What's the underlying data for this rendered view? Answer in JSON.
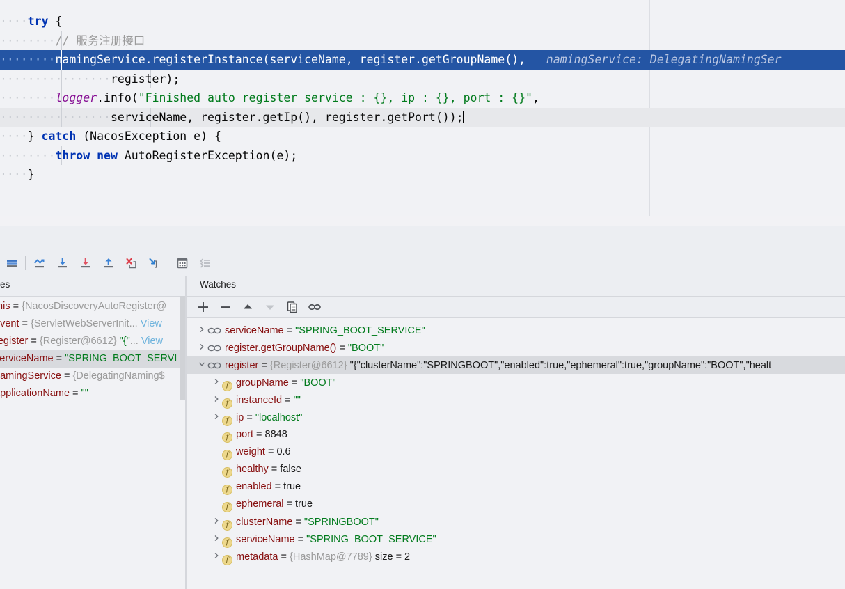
{
  "editor": {
    "lines": [
      {
        "indent_dots": "····",
        "guides": [],
        "segments": [
          {
            "t": "try",
            "c": "kw"
          },
          {
            "t": " {",
            "c": "plain"
          }
        ]
      },
      {
        "indent_dots": "········",
        "guides": [
          88
        ],
        "segments": [
          {
            "t": "// 服务注册接口",
            "c": "cmt"
          }
        ]
      },
      {
        "indent_dots": "········",
        "guides": [
          88
        ],
        "selected": true,
        "segments": [
          {
            "t": "namingService.registerInstance(",
            "c": "plain"
          },
          {
            "t": "serviceName",
            "c": "underl"
          },
          {
            "t": ", register.getGroupName(),",
            "c": "plain"
          }
        ],
        "hint": "namingService: DelegatingNamingSer"
      },
      {
        "indent_dots": "················",
        "guides": [
          88,
          216
        ],
        "segments": [
          {
            "t": "register);",
            "c": "plain"
          }
        ]
      },
      {
        "indent_dots": "········",
        "guides": [
          88
        ],
        "segments": [
          {
            "t": "logger",
            "c": "fld"
          },
          {
            "t": ".info(",
            "c": "plain"
          },
          {
            "t": "\"Finished auto register service : {}, ip : {}, port : {}\"",
            "c": "str"
          },
          {
            "t": ",",
            "c": "plain"
          }
        ]
      },
      {
        "indent_dots": "················",
        "guides": [
          88,
          216
        ],
        "caret_line": true,
        "segments": [
          {
            "t": "serviceName",
            "c": "underl"
          },
          {
            "t": ", register.getIp(), register.getPort());",
            "c": "plain"
          }
        ],
        "caret": true
      },
      {
        "indent_dots": "····",
        "guides": [],
        "segments": [
          {
            "t": "} ",
            "c": "plain"
          },
          {
            "t": "catch",
            "c": "kw"
          },
          {
            "t": " (NacosException e) {",
            "c": "plain"
          }
        ]
      },
      {
        "indent_dots": "········",
        "guides": [
          88
        ],
        "segments": [
          {
            "t": "throw",
            "c": "kw"
          },
          {
            "t": " ",
            "c": "plain"
          },
          {
            "t": "new",
            "c": "kw"
          },
          {
            "t": " AutoRegisterException(e);",
            "c": "plain"
          }
        ]
      },
      {
        "indent_dots": "····",
        "guides": [],
        "segments": [
          {
            "t": "}",
            "c": "plain"
          }
        ]
      }
    ],
    "scrollbar": {
      "orientation": "horizontal"
    }
  },
  "debug_toolbar": {
    "buttons": [
      {
        "name": "show-execution-point-icon",
        "label": "Show Execution Point"
      },
      {
        "name": "step-over-icon",
        "label": "Step Over"
      },
      {
        "name": "step-into-icon",
        "label": "Step Into"
      },
      {
        "name": "force-step-into-icon",
        "label": "Force Step Into"
      },
      {
        "name": "step-out-icon",
        "label": "Step Out"
      },
      {
        "name": "drop-frame-icon",
        "label": "Drop Frame"
      },
      {
        "name": "run-to-cursor-icon",
        "label": "Run to Cursor"
      },
      {
        "name": "evaluate-expression-icon",
        "label": "Evaluate Expression"
      },
      {
        "name": "sort-values-icon",
        "label": "Sort Values"
      }
    ]
  },
  "variables_panel": {
    "tab_label": "es",
    "rows": [
      {
        "name": "this",
        "eq": " = ",
        "obj": "{NacosDiscoveryAutoRegister@",
        "value": "",
        "link": ""
      },
      {
        "name": "event",
        "eq": " = ",
        "obj": "{ServletWebServerInit",
        "ellipsis": "... ",
        "link": "View"
      },
      {
        "name": "register",
        "eq": " = ",
        "obj": "{Register@6612} ",
        "value": "\"{\"",
        "ellipsis": "... ",
        "link": "View"
      },
      {
        "name": "serviceName",
        "eq": " = ",
        "value": "\"SPRING_BOOT_SERVI",
        "selected": true
      },
      {
        "name": "namingService",
        "eq": " = ",
        "obj": "{DelegatingNaming$"
      },
      {
        "name": "applicationName",
        "eq": " = ",
        "value": "\"\""
      }
    ]
  },
  "watches_panel": {
    "tab_label": "Watches",
    "toolbar": [
      {
        "name": "add-watch-button",
        "label": "+"
      },
      {
        "name": "remove-watch-button",
        "label": "−"
      },
      {
        "name": "move-watch-up-button",
        "label": "▲"
      },
      {
        "name": "move-watch-down-button",
        "label": "▼"
      },
      {
        "name": "copy-value-button",
        "label": "copy"
      },
      {
        "name": "watch-glasses-button",
        "label": "watch"
      }
    ],
    "rows": [
      {
        "indent": 0,
        "twisty": "collapsed",
        "icon": "watch",
        "name": "serviceName",
        "eq": " = ",
        "value": "\"SPRING_BOOT_SERVICE\"",
        "value_kind": "string"
      },
      {
        "indent": 0,
        "twisty": "collapsed",
        "icon": "watch",
        "name": "register.getGroupName()",
        "eq": " = ",
        "value": "\"BOOT\"",
        "value_kind": "string"
      },
      {
        "indent": 0,
        "twisty": "expanded",
        "icon": "watch",
        "name": "register",
        "eq": " = ",
        "obj": "{Register@6612} ",
        "value": "\"{\"clusterName\":\"SPRINGBOOT\",\"enabled\":true,\"ephemeral\":true,\"groupName\":\"BOOT\",\"healt",
        "value_kind": "raw",
        "selected": true
      },
      {
        "indent": 1,
        "twisty": "collapsed",
        "icon": "field",
        "name": "groupName",
        "eq": " = ",
        "value": "\"BOOT\"",
        "value_kind": "string"
      },
      {
        "indent": 1,
        "twisty": "collapsed",
        "icon": "field",
        "name": "instanceId",
        "eq": " = ",
        "value": "\"\"",
        "value_kind": "string"
      },
      {
        "indent": 1,
        "twisty": "collapsed",
        "icon": "field",
        "name": "ip",
        "eq": " = ",
        "value": "\"localhost\"",
        "value_kind": "string"
      },
      {
        "indent": 1,
        "twisty": "none",
        "icon": "field",
        "name": "port",
        "eq": " = ",
        "value": "8848",
        "value_kind": "number"
      },
      {
        "indent": 1,
        "twisty": "none",
        "icon": "field",
        "name": "weight",
        "eq": " = ",
        "value": "0.6",
        "value_kind": "number"
      },
      {
        "indent": 1,
        "twisty": "none",
        "icon": "field",
        "name": "healthy",
        "eq": " = ",
        "value": "false",
        "value_kind": "number"
      },
      {
        "indent": 1,
        "twisty": "none",
        "icon": "field",
        "name": "enabled",
        "eq": " = ",
        "value": "true",
        "value_kind": "number"
      },
      {
        "indent": 1,
        "twisty": "none",
        "icon": "field",
        "name": "ephemeral",
        "eq": " = ",
        "value": "true",
        "value_kind": "number"
      },
      {
        "indent": 1,
        "twisty": "collapsed",
        "icon": "field",
        "name": "clusterName",
        "eq": " = ",
        "value": "\"SPRINGBOOT\"",
        "value_kind": "string"
      },
      {
        "indent": 1,
        "twisty": "collapsed",
        "icon": "field",
        "name": "serviceName",
        "eq": " = ",
        "value": "\"SPRING_BOOT_SERVICE\"",
        "value_kind": "string"
      },
      {
        "indent": 1,
        "twisty": "collapsed",
        "icon": "field",
        "name": "metadata",
        "eq": " = ",
        "obj": "{HashMap@7789} ",
        "value": "size = 2",
        "value_kind": "raw"
      }
    ]
  },
  "colors": {
    "selection_blue": "#2455a4",
    "keyword": "#0033b3",
    "string": "#027b1d",
    "field_name": "#871010",
    "object_ref": "#9a9a9a",
    "panel_bg": "#f1f2f5",
    "toolbar_bg": "#eceef2",
    "row_selected": "#d8dade"
  }
}
